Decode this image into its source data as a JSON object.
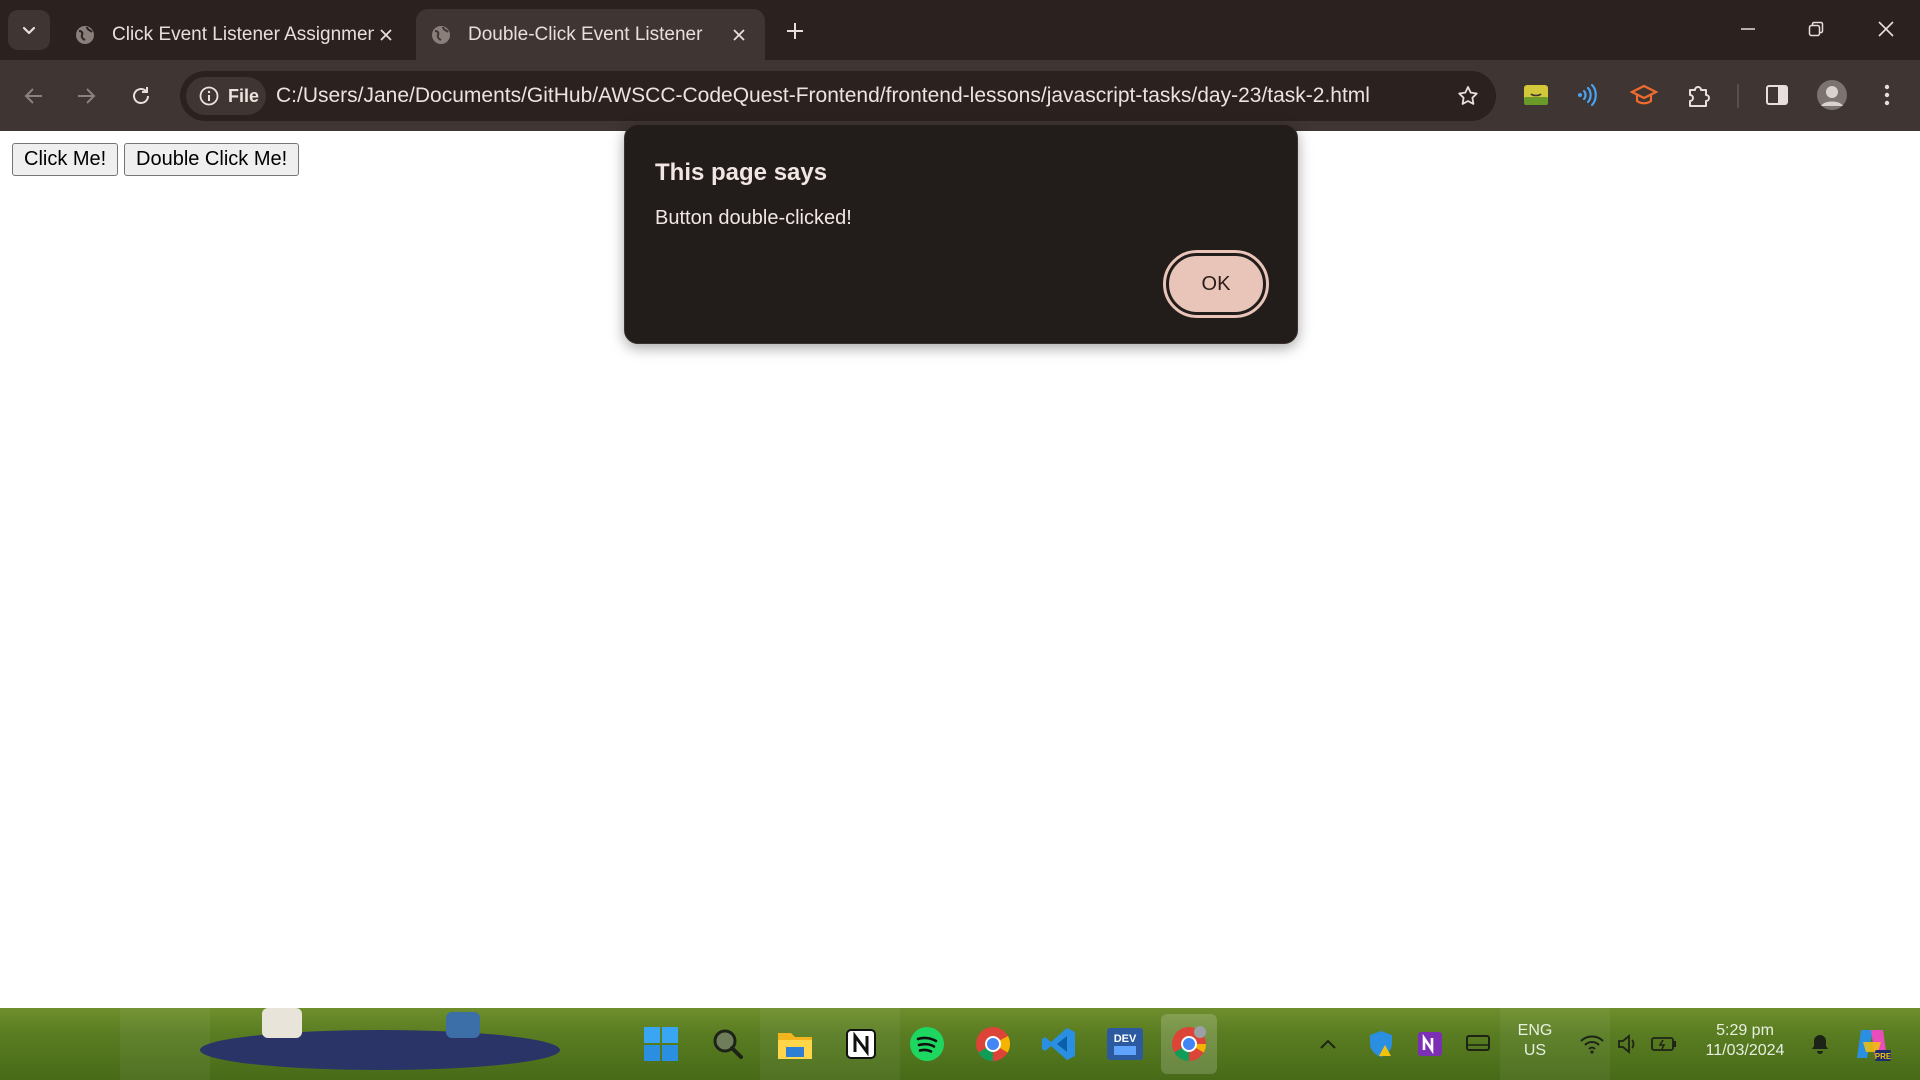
{
  "browser": {
    "tabs": [
      {
        "title": "Click Event Listener Assignment",
        "active": false
      },
      {
        "title": "Double-Click Event Listener",
        "active": true
      }
    ],
    "omnibox": {
      "chip_label": "File",
      "url": "C:/Users/Jane/Documents/GitHub/AWSCC-CodeQuest-Frontend/frontend-lessons/javascript-tasks/day-23/task-2.html"
    }
  },
  "page": {
    "buttons": [
      {
        "label": "Click Me!"
      },
      {
        "label": "Double Click Me!"
      }
    ]
  },
  "dialog": {
    "title": "This page says",
    "message": "Button double-clicked!",
    "ok_label": "OK"
  },
  "taskbar": {
    "pinned": [
      "windows-start",
      "search",
      "file-explorer",
      "notion",
      "spotify",
      "chrome",
      "vscode",
      "devhome",
      "chrome-canary"
    ],
    "tray": {
      "language_top": "ENG",
      "language_bottom": "US",
      "time": "5:29 pm",
      "date": "11/03/2024"
    }
  },
  "colors": {
    "chrome_frame": "#2b2220",
    "chrome_toolbar": "#3f3532",
    "dialog_bg": "#221c1b",
    "ok_button": "#e8c5b8"
  }
}
